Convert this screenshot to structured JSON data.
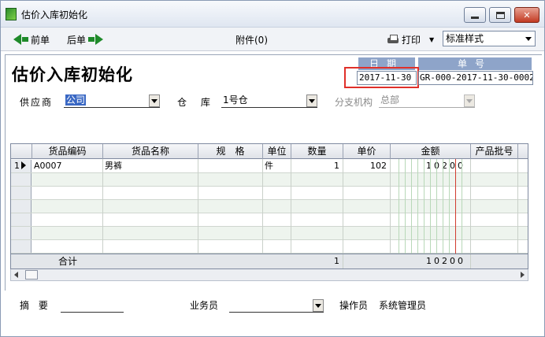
{
  "window": {
    "title": "估价入库初始化"
  },
  "toolbar": {
    "prev_label": "前单",
    "next_label": "后单",
    "attach_label": "附件(0)",
    "print_label": "打印",
    "style_value": "标准样式"
  },
  "form": {
    "title": "估价入库初始化",
    "date_label": "日期",
    "date_value": "2017-11-30",
    "no_label": "单号",
    "no_value": "GR-000-2017-11-30-0002",
    "supplier_label": "供应商",
    "supplier_value": "公司",
    "warehouse_label": "仓 库",
    "warehouse_value": "1号仓",
    "branch_label": "分支机构",
    "branch_value": "总部"
  },
  "grid": {
    "headers": [
      "货品编码",
      "货品名称",
      "规　格",
      "单位",
      "数量",
      "单价",
      "金额",
      "产品批号"
    ],
    "rows": [
      {
        "index": "1",
        "code": "A0007",
        "name": "男裤",
        "spec": "",
        "unit": "件",
        "qty": "1",
        "price": "102",
        "amount": "10200"
      }
    ],
    "total_label": "合计",
    "total_qty": "1",
    "total_amount": "10200"
  },
  "footer": {
    "remark_label": "摘 要",
    "salesman_label": "业务员",
    "operator_label": "操作员",
    "operator_value": "系统管理员"
  },
  "colors": {
    "highlight_red": "#e0302a",
    "select_blue": "#3a68c4",
    "header_blue": "#8ea4c9",
    "arrow_green": "#1f8a2a"
  }
}
